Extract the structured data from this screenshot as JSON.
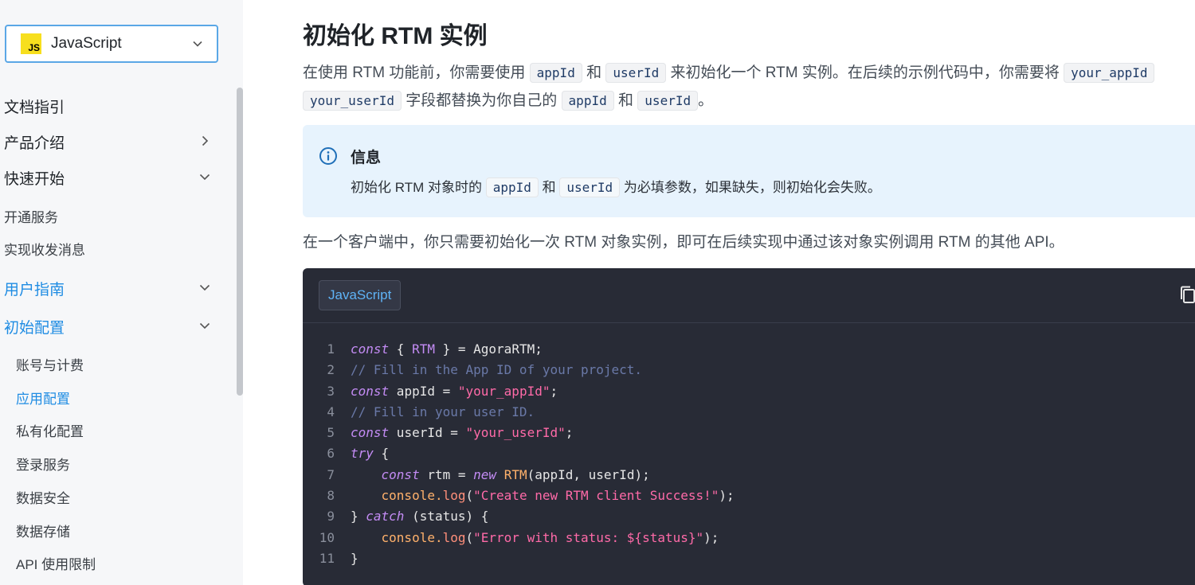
{
  "sidebar": {
    "language_select": {
      "value": "JavaScript",
      "icon": "JS"
    },
    "items": [
      {
        "label": "文档指引"
      },
      {
        "label": "产品介绍"
      },
      {
        "label": "快速开始"
      },
      {
        "label": "开通服务"
      },
      {
        "label": "实现收发消息"
      },
      {
        "label": "用户指南"
      },
      {
        "label": "初始配置"
      },
      {
        "label": "账号与计费"
      },
      {
        "label": "应用配置"
      },
      {
        "label": "私有化配置"
      },
      {
        "label": "登录服务"
      },
      {
        "label": "数据安全"
      },
      {
        "label": "数据存储"
      },
      {
        "label": "API 使用限制"
      }
    ]
  },
  "main": {
    "title": "初始化 RTM 实例",
    "intro": {
      "t1": "在使用 RTM 功能前，你需要使用",
      "c1": "appId",
      "t2": "和",
      "c2": "userId",
      "t3": "来初始化一个 RTM 实例。在后续的示例代码中，你需要将",
      "c3": "your_appId",
      "c4": "your_userId",
      "t4": "字段都替换为你自己的",
      "c5": "appId",
      "t5": "和",
      "c6": "userId",
      "t6": "。"
    },
    "info": {
      "title": "信息",
      "t1": "初始化 RTM 对象时的",
      "c1": "appId",
      "t2": "和",
      "c2": "userId",
      "t3": "为必填参数，如果缺失，则初始化会失败。"
    },
    "para2": "在一个客户端中，你只需要初始化一次 RTM 对象实例，即可在后续实现中通过该对象实例调用 RTM 的其他 API。",
    "code": {
      "tab": "JavaScript",
      "line_numbers": [
        "1",
        "2",
        "3",
        "4",
        "5",
        "6",
        "7",
        "8",
        "9",
        "10",
        "11"
      ],
      "l1": {
        "a": "const",
        "b": " { ",
        "c": "RTM",
        "d": " } = AgoraRTM;"
      },
      "l2": "// Fill in the App ID of your project.",
      "l3": {
        "a": "const",
        "b": " appId = ",
        "c": "\"your_appId\"",
        "d": ";"
      },
      "l4": "// Fill in your user ID.",
      "l5": {
        "a": "const",
        "b": " userId = ",
        "c": "\"your_userId\"",
        "d": ";"
      },
      "l6": {
        "a": "try",
        "b": " {"
      },
      "l7": {
        "a": "const",
        "b": " rtm = ",
        "c": "new",
        "d": "RTM",
        "e": "(appId, userId);"
      },
      "l8": {
        "a": "console.",
        "b": "log",
        "c": "(",
        "d": "\"Create new RTM client Success!\"",
        "e": ");"
      },
      "l9": {
        "a": "} ",
        "b": "catch",
        "c": " (status) {"
      },
      "l10": {
        "a": "console.",
        "b": "log",
        "c": "(",
        "d": "\"Error with status: ${status}\"",
        "e": ");"
      },
      "l11": "}"
    }
  }
}
